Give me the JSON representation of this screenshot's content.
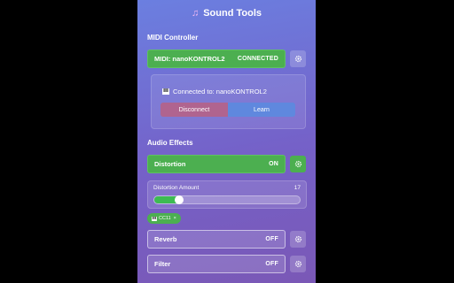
{
  "title": {
    "icon": "music-note-icon",
    "text": "Sound Tools"
  },
  "midi": {
    "section": "MIDI Controller",
    "button_label": "MIDI: nanoKONTROL2",
    "button_state": "CONNECTED",
    "connected_text": "Connected to: nanoKONTROL2",
    "disconnect_label": "Disconnect",
    "learn_label": "Learn"
  },
  "effects": {
    "section": "Audio Effects",
    "distortion": {
      "label": "Distortion",
      "state": "ON"
    },
    "amount": {
      "label": "Distortion Amount",
      "value": "17",
      "fraction": 0.17
    },
    "cc_badge": {
      "label": "CC11",
      "remove": "×"
    },
    "reverb": {
      "label": "Reverb",
      "state": "OFF"
    },
    "filter": {
      "label": "Filter",
      "state": "OFF"
    }
  },
  "colors": {
    "accent_green": "#4caf50",
    "disconnect": "#b0648f",
    "learn": "#5f88de",
    "panel_top": "#6b7fe0",
    "panel_bottom": "#7a58b6"
  }
}
